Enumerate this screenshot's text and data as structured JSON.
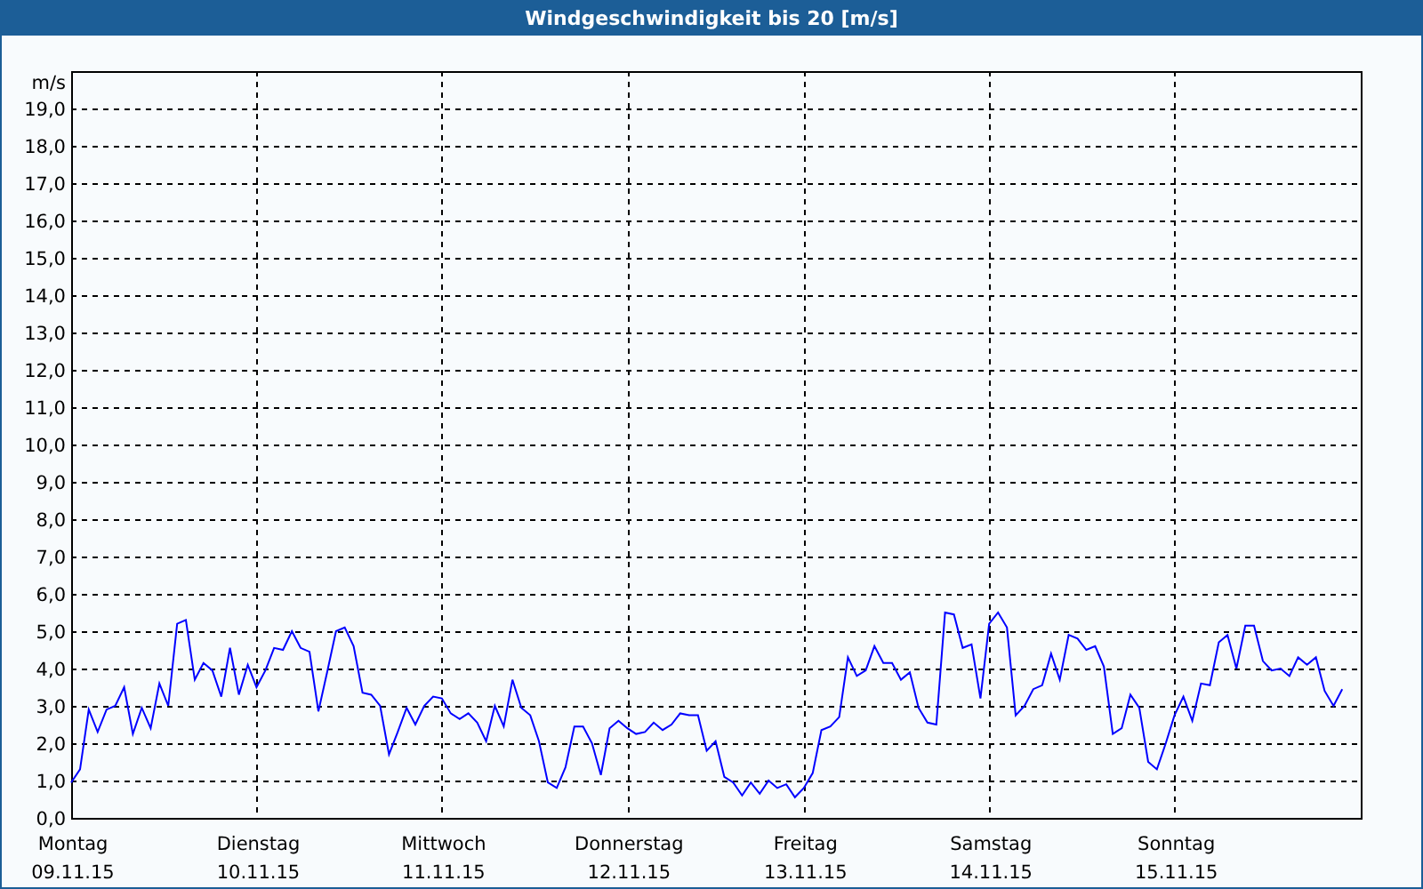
{
  "chart_data": {
    "type": "line",
    "grid": true,
    "title": "Windgeschwindigkeit bis 20 [m/s]",
    "ylabel": "m/s",
    "ylim": [
      0,
      20
    ],
    "yticks": [
      {
        "value": 0,
        "label": "0,0"
      },
      {
        "value": 1,
        "label": "1,0"
      },
      {
        "value": 2,
        "label": "2,0"
      },
      {
        "value": 3,
        "label": "3,0"
      },
      {
        "value": 4,
        "label": "4,0"
      },
      {
        "value": 5,
        "label": "5,0"
      },
      {
        "value": 6,
        "label": "6,0"
      },
      {
        "value": 7,
        "label": "7,0"
      },
      {
        "value": 8,
        "label": "8,0"
      },
      {
        "value": 9,
        "label": "9,0"
      },
      {
        "value": 10,
        "label": "10,0"
      },
      {
        "value": 11,
        "label": "11,0"
      },
      {
        "value": 12,
        "label": "12,0"
      },
      {
        "value": 13,
        "label": "13,0"
      },
      {
        "value": 14,
        "label": "14,0"
      },
      {
        "value": 15,
        "label": "15,0"
      },
      {
        "value": 16,
        "label": "16,0"
      },
      {
        "value": 17,
        "label": "17,0"
      },
      {
        "value": 18,
        "label": "18,0"
      },
      {
        "value": 19,
        "label": "19,0"
      }
    ],
    "categories": [
      "Montag",
      null,
      null,
      null,
      null,
      null,
      null,
      null,
      null,
      null,
      null,
      null,
      null,
      null,
      null,
      null,
      null,
      null,
      null,
      null,
      null,
      "Dienstag",
      null,
      null,
      null,
      null,
      null,
      null,
      null,
      null,
      null,
      null,
      null,
      null,
      null,
      null,
      null,
      null,
      null,
      null,
      null,
      null,
      "Mittwoch",
      null,
      null,
      null,
      null,
      null,
      null,
      null,
      null,
      null,
      null,
      null,
      null,
      null,
      null,
      null,
      null,
      null,
      null,
      null,
      null,
      "Donnerstag",
      null,
      null,
      null,
      null,
      null,
      null,
      null,
      null,
      null,
      null,
      null,
      null,
      null,
      null,
      null,
      null,
      null,
      null,
      null,
      "Freitag",
      null,
      null,
      null,
      null,
      null,
      null,
      null,
      null,
      null,
      null,
      null,
      null,
      null,
      null,
      null,
      null,
      null,
      null,
      null,
      null,
      "Samstag",
      null,
      null,
      null,
      null,
      null,
      null,
      null,
      null,
      null,
      null,
      null,
      null,
      null,
      null,
      null,
      null,
      null,
      null,
      null,
      null,
      "Sonntag",
      null,
      null,
      null,
      null,
      null,
      null,
      null,
      null,
      null,
      null,
      null,
      null,
      null,
      null,
      null,
      null,
      null,
      null,
      null
    ],
    "series": [
      {
        "color": "#0000ff",
        "values": [
          0.95,
          1.3,
          2.9,
          2.3,
          2.9,
          3.0,
          3.5,
          2.25,
          2.95,
          2.4,
          3.6,
          3.0,
          5.2,
          5.3,
          3.7,
          4.15,
          3.95,
          3.25,
          4.55,
          3.3,
          4.1,
          3.5,
          3.95,
          4.55,
          4.5,
          5.0,
          4.55,
          4.45,
          2.85,
          3.9,
          5.0,
          5.1,
          4.6,
          3.35,
          3.3,
          3.0,
          1.7,
          2.3,
          2.95,
          2.5,
          3.0,
          3.25,
          3.2,
          2.8,
          2.65,
          2.8,
          2.55,
          2.05,
          3.0,
          2.45,
          3.7,
          2.95,
          2.75,
          2.05,
          0.95,
          0.8,
          1.35,
          2.45,
          2.45,
          2.0,
          1.15,
          2.4,
          2.6,
          2.4,
          2.25,
          2.3,
          2.55,
          2.35,
          2.5,
          2.8,
          2.75,
          2.75,
          1.8,
          2.05,
          1.1,
          0.95,
          0.6,
          0.95,
          0.65,
          1.0,
          0.8,
          0.9,
          0.55,
          0.8,
          1.2,
          2.35,
          2.45,
          2.7,
          4.3,
          3.8,
          3.95,
          4.6,
          4.15,
          4.15,
          3.7,
          3.9,
          2.95,
          2.55,
          2.5,
          5.5,
          5.45,
          4.55,
          4.65,
          3.2,
          5.2,
          5.5,
          5.1,
          2.75,
          3.0,
          3.45,
          3.55,
          4.4,
          3.7,
          4.9,
          4.8,
          4.5,
          4.6,
          4.05,
          2.25,
          2.4,
          3.3,
          2.95,
          1.5,
          1.3,
          2.0,
          2.75,
          3.25,
          2.6,
          3.6,
          3.55,
          4.7,
          4.9,
          4.0,
          5.15,
          5.15,
          4.2,
          3.95,
          4.0,
          3.8,
          4.3,
          4.1,
          4.3,
          3.4,
          3.0,
          3.45
        ]
      }
    ]
  },
  "dates": [
    "09.11.15",
    "10.11.15",
    "11.11.15",
    "12.11.15",
    "13.11.15",
    "14.11.15",
    "15.11.15"
  ]
}
